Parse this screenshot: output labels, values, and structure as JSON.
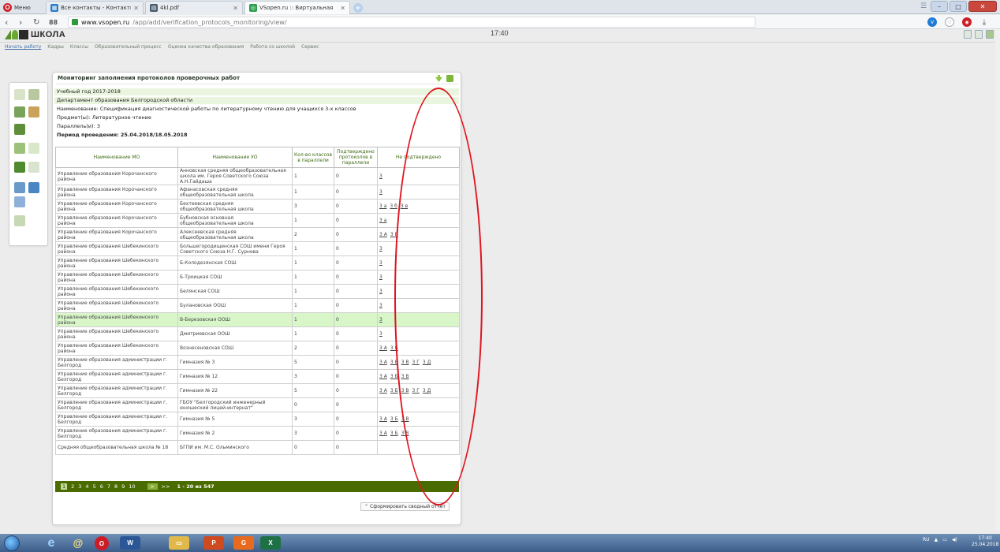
{
  "browser": {
    "menu_label": "Меню",
    "tabs": [
      {
        "title": "Все контакты - Контакты",
        "icon": "contacts-icon",
        "color": "#2a7cc7",
        "active": false
      },
      {
        "title": "4kl.pdf",
        "icon": "pdf-icon",
        "color": "#4a5a6a",
        "active": false
      },
      {
        "title": "VSopen.ru :: Виртуальная",
        "icon": "vsopen-icon",
        "color": "#2b9e4b",
        "active": true
      }
    ],
    "new_tab": "+",
    "url_host": "www.vsopen.ru",
    "url_path": "/app/add/verification_protocols_monitoring/view/",
    "speed_dial": "88"
  },
  "app": {
    "logo_text": "ШКОЛА",
    "clock": "17:40",
    "menu": [
      "Начать работу",
      "Кадры",
      "Классы",
      "Образовательный процесс",
      "Оценка качества образования",
      "Работа со школой",
      "Сервис"
    ]
  },
  "panel": {
    "title": "Мониторинг заполнения протоколов проверочных работ",
    "year": "Учебный год 2017-2018",
    "department": "Департамент образования Белгородской области",
    "name": "Наименование: Спецификация диагностической работы по литературному чтению для учащихся 3-х классов",
    "subject": "Предмет(ы): Литературное чтение",
    "parallel": "Параллель(и): 3",
    "period": "Период проведения: 25.04.2018/18.05.2018",
    "columns": [
      "Наименование МО",
      "Наименование УО",
      "Кол-во классов в параллели",
      "Подтверждено протоколов в параллели",
      "Не подтверждено"
    ],
    "rows": [
      {
        "mo": "Управление образования Корочанского района",
        "uo": "Анновская средняя общеобразовательная школа им. Героя Советского Союза А.Н.Гайдаша",
        "classes": "1",
        "confirmed": "0",
        "not_confirmed": [
          "3"
        ]
      },
      {
        "mo": "Управление образования Корочанского района",
        "uo": "Афанасовская средняя общеобразовательная школа",
        "classes": "1",
        "confirmed": "0",
        "not_confirmed": [
          "3"
        ]
      },
      {
        "mo": "Управление образования Корочанского района",
        "uo": "Бехтеевская средняя общеобразовательная школа",
        "classes": "3",
        "confirmed": "0",
        "not_confirmed": [
          "3 а",
          "3 б",
          "3 в"
        ]
      },
      {
        "mo": "Управление образования Корочанского района",
        "uo": "Бубновская основная общеобразовательная школа",
        "classes": "1",
        "confirmed": "0",
        "not_confirmed": [
          "3 а"
        ]
      },
      {
        "mo": "Управление образования Корочанского района",
        "uo": "Алексеевская средняя общеобразовательная школа",
        "classes": "2",
        "confirmed": "0",
        "not_confirmed": [
          "3 А",
          "3 Б"
        ]
      },
      {
        "mo": "Управление образования Шебекинского района",
        "uo": "Большегородищенская СОШ имени Героя Советского Союза Н.Г. Сурнева",
        "classes": "1",
        "confirmed": "0",
        "not_confirmed": [
          "3"
        ]
      },
      {
        "mo": "Управление образования Шебекинского района",
        "uo": "Б-Колодезянская СОШ",
        "classes": "1",
        "confirmed": "0",
        "not_confirmed": [
          "3"
        ]
      },
      {
        "mo": "Управление образования Шебекинского района",
        "uo": "Б-Троицкая СОШ",
        "classes": "1",
        "confirmed": "0",
        "not_confirmed": [
          "3"
        ]
      },
      {
        "mo": "Управление образования Шебекинского района",
        "uo": "Белянская СОШ",
        "classes": "1",
        "confirmed": "0",
        "not_confirmed": [
          "3"
        ]
      },
      {
        "mo": "Управление образования Шебекинского района",
        "uo": "Булановская ООШ",
        "classes": "1",
        "confirmed": "0",
        "not_confirmed": [
          "3"
        ]
      },
      {
        "mo": "Управление образования Шебекинского района",
        "uo": "В-Березовская ООШ",
        "classes": "1",
        "confirmed": "0",
        "not_confirmed": [
          "3"
        ],
        "selected": true
      },
      {
        "mo": "Управление образования Шебекинского района",
        "uo": "Дмитриевская ООШ",
        "classes": "1",
        "confirmed": "0",
        "not_confirmed": [
          "3"
        ]
      },
      {
        "mo": "Управление образования Шебекинского района",
        "uo": "Вознесеновская СОШ",
        "classes": "2",
        "confirmed": "0",
        "not_confirmed": [
          "3 А",
          "3 Б"
        ]
      },
      {
        "mo": "Управление образования администрации г. Белгород",
        "uo": "Гимназия № 3",
        "classes": "5",
        "confirmed": "0",
        "not_confirmed": [
          "3 А",
          "3 Б",
          "3 В",
          "3 Г",
          "3 Д"
        ]
      },
      {
        "mo": "Управление образования администрации г. Белгород",
        "uo": "Гимназия № 12",
        "classes": "3",
        "confirmed": "0",
        "not_confirmed": [
          "3 А",
          "3 Б",
          "3 В"
        ]
      },
      {
        "mo": "Управление образования администрации г. Белгород",
        "uo": "Гимназия № 22",
        "classes": "5",
        "confirmed": "0",
        "not_confirmed": [
          "3 А",
          "3 Б",
          "3 В",
          "3 Г",
          "3 Д"
        ]
      },
      {
        "mo": "Управление образования администрации г. Белгород",
        "uo": "ГБОУ \"Белгородский инженерный юношеский лицей-интернат\"",
        "classes": "0",
        "confirmed": "0",
        "not_confirmed": []
      },
      {
        "mo": "Управление образования администрации г. Белгород",
        "uo": "Гимназия № 5",
        "classes": "3",
        "confirmed": "0",
        "not_confirmed": [
          "3 А",
          "3 Б",
          "3 В"
        ]
      },
      {
        "mo": "Управление образования администрации г. Белгород",
        "uo": "Гимназия № 2",
        "classes": "3",
        "confirmed": "0",
        "not_confirmed": [
          "3 А",
          "3 Б",
          "3 В"
        ]
      },
      {
        "mo": "Средняя общеобразовательная школа № 18",
        "uo": "БГПИ им. М.С. Ольминского",
        "classes": "0",
        "confirmed": "0",
        "not_confirmed": []
      }
    ],
    "pager": {
      "pages": [
        "1",
        "2",
        "3",
        "4",
        "5",
        "6",
        "7",
        "8",
        "9",
        "10"
      ],
      "current": "1",
      "next": ">",
      "last": ">>",
      "range": "1 - 20 из 547"
    },
    "report_button": "Сформировать сводный отчёт"
  },
  "taskbar": {
    "lang": "RU",
    "time": "17:40",
    "date": "25.04.2018"
  },
  "colors": {
    "accent_green": "#4a6b00",
    "annotation_red": "#e0141e",
    "selected_row": "#d8f6c8"
  }
}
